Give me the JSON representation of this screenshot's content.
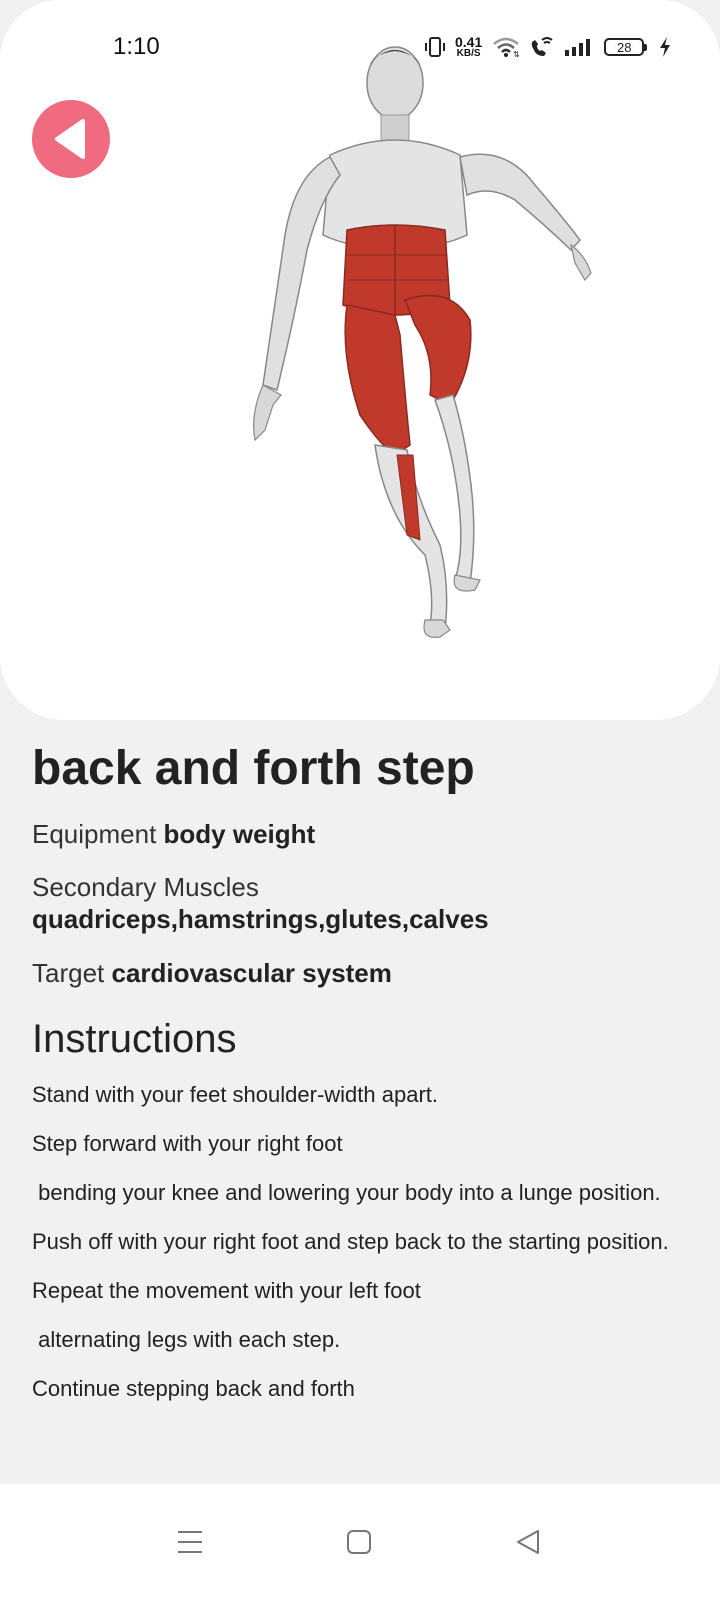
{
  "status_bar": {
    "time": "1:10",
    "net_speed_value": "0.41",
    "net_speed_unit": "KB/S",
    "battery_level": "28",
    "icons": [
      "vibrate-icon",
      "wifi-icon",
      "wifi-calling-icon",
      "signal-icon",
      "battery-icon",
      "charging-icon"
    ]
  },
  "header": {
    "back_icon": "back-arrow-icon",
    "back_color": "#f06a80"
  },
  "exercise": {
    "name": "back and forth step",
    "equipment_label": "Equipment ",
    "equipment_value": "body weight",
    "secondary_label": "Secondary Muscles",
    "secondary_value": "quadriceps,hamstrings,glutes,calves",
    "target_label": "Target ",
    "target_value": "cardiovascular system",
    "instructions_heading": "Instructions",
    "instructions": [
      "Stand with your feet shoulder-width apart.",
      "Step forward with your right foot",
      " bending your knee and lowering your body into a lunge position.",
      "Push off with your right foot and step back to the starting position.",
      "Repeat the movement with your left foot",
      " alternating legs with each step.",
      "Continue stepping back and forth"
    ]
  },
  "nav_bar": {
    "icons": [
      "menu-icon",
      "home-square-icon",
      "back-triangle-icon"
    ]
  }
}
